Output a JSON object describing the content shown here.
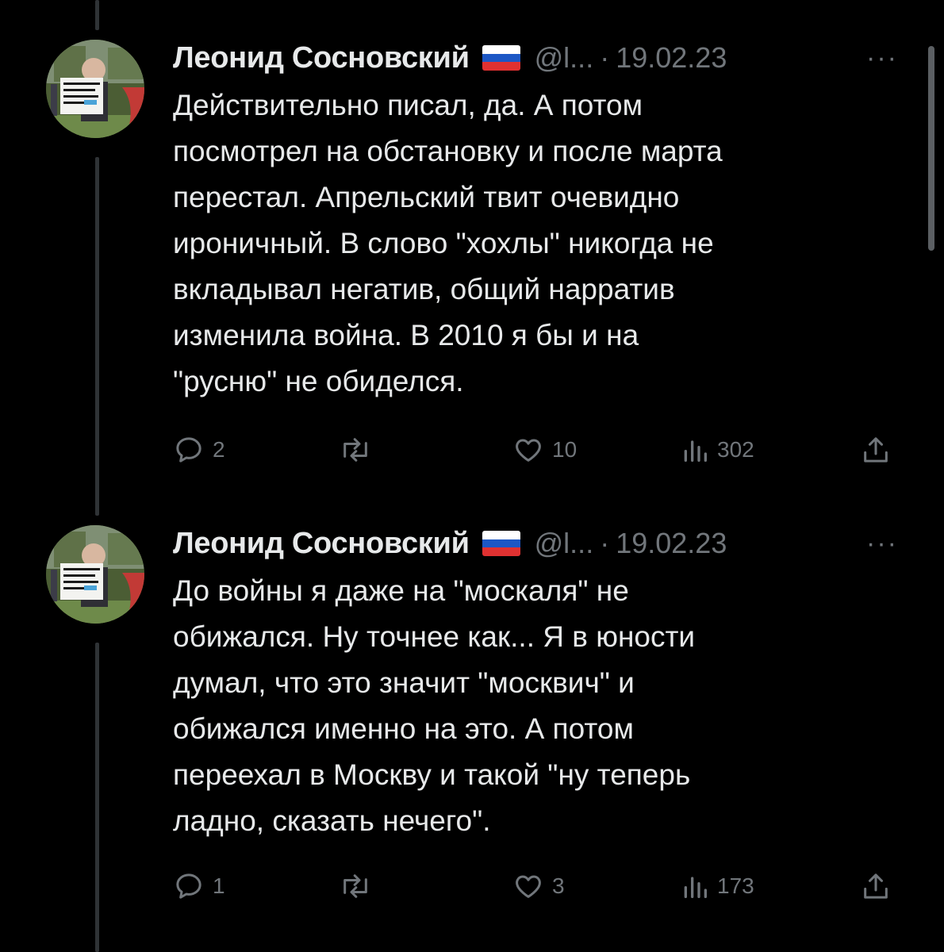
{
  "tweets": [
    {
      "author": "Леонид Сосновский",
      "handle": "@l...",
      "separator": "·",
      "date": "19.02.23",
      "more": "···",
      "text": "Действительно писал, да. А потом\nпосмотрел на обстановку и после марта\nперестал. Апрельский твит очевидно\nироничный. В слово \"хохлы\" никогда не\nвкладывал негатив, общий нарратив\nизменила война. В 2010 я бы и на\n\"русню\" не обиделся.",
      "stats": {
        "replies": "2",
        "likes": "10",
        "views": "302"
      }
    },
    {
      "author": "Леонид Сосновский",
      "handle": "@l...",
      "separator": "·",
      "date": "19.02.23",
      "more": "···",
      "text": "До войны я даже на \"москаля\" не\nобижался. Ну точнее как... Я в юности\nдумал, что это значит \"москвич\" и\nобижался именно на это. А потом\nпереехал в Москву и такой \"ну теперь\nладно, сказать нечего\".",
      "stats": {
        "replies": "1",
        "likes": "3",
        "views": "173"
      }
    }
  ],
  "colors": {
    "background": "#000000",
    "text": "#e7e9ea",
    "muted": "#71767b",
    "thread_line": "#2f3336"
  },
  "icons": [
    "reply-icon",
    "retweet-icon",
    "like-icon",
    "views-icon",
    "share-icon",
    "more-icon",
    "russia-flag-icon"
  ]
}
